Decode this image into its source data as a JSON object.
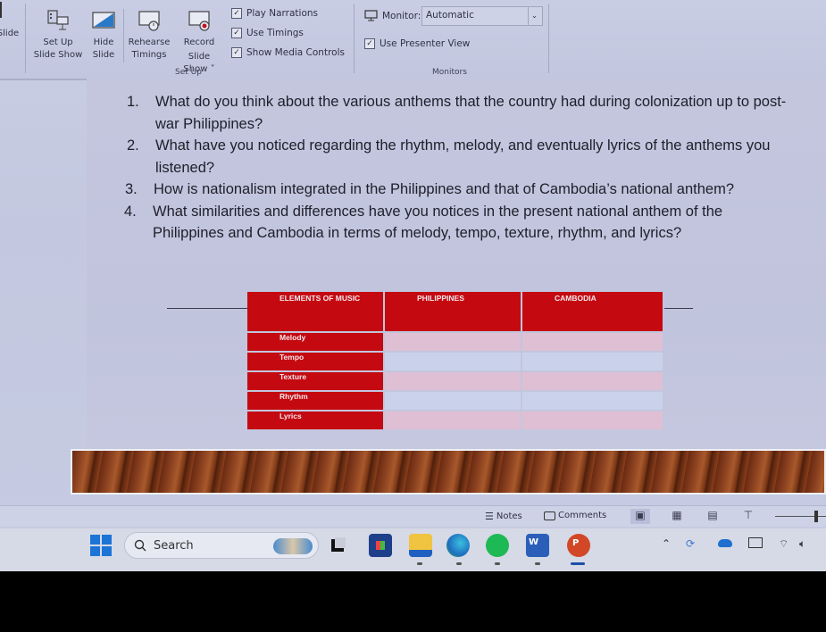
{
  "ribbon": {
    "partial_left_label": "Slide",
    "buttons": {
      "setup_slideshow": "Set Up\nSlide Show",
      "setup_line1": "Set Up",
      "setup_line2": "Slide Show",
      "hide_line1": "Hide",
      "hide_line2": "Slide",
      "rehearse_line1": "Rehearse",
      "rehearse_line2": "Timings",
      "record_line1": "Record Slide",
      "record_line2": "Show ˅"
    },
    "checkboxes": [
      {
        "label": "Play Narrations",
        "checked": true
      },
      {
        "label": "Use Timings",
        "checked": true
      },
      {
        "label": "Show Media Controls",
        "checked": true
      }
    ],
    "setup_group_label": "Set Up",
    "monitor_label": "Monitor:",
    "monitor_value": "Automatic",
    "presenter_view": {
      "label": "Use Presenter View",
      "checked": true
    },
    "monitors_group_label": "Monitors",
    "check_glyph": "✓"
  },
  "slide": {
    "questions": [
      {
        "num": "1.",
        "text": "What do you think about the various anthems that the country had during colonization up to post-war Philippines?"
      },
      {
        "num": "2.",
        "text": "What have you noticed regarding the rhythm, melody, and eventually lyrics of the anthems you listened?"
      },
      {
        "num": "3.",
        "text": "How is nationalism integrated in the Philippines and that of Cambodia’s national anthem?"
      },
      {
        "num": "4.",
        "text": "What similarities and differences have you notices in the present national anthem of the Philippines and Cambodia in terms of melody, tempo, texture, rhythm, and lyrics?"
      }
    ],
    "table": {
      "headers": [
        "ELEMENTS OF MUSIC",
        "PHILIPPINES",
        "CAMBODIA"
      ],
      "rows": [
        {
          "label": "Melody",
          "philippines": "",
          "cambodia": ""
        },
        {
          "label": "Tempo",
          "philippines": "",
          "cambodia": ""
        },
        {
          "label": "Texture",
          "philippines": "",
          "cambodia": ""
        },
        {
          "label": "Rhythm",
          "philippines": "",
          "cambodia": ""
        },
        {
          "label": "Lyrics",
          "philippines": "",
          "cambodia": ""
        }
      ],
      "colors": {
        "header": "#c40a10",
        "row_pink": "#dfbfd3",
        "row_blue": "#c9d2ea"
      }
    }
  },
  "statusbar": {
    "notes_label": "Notes",
    "comments_label": "Comments",
    "views": [
      "normal-view",
      "slide-sorter",
      "reading-view",
      "slide-show"
    ]
  },
  "taskbar": {
    "search_placeholder": "Search",
    "apps": [
      "task-view",
      "microsoft-store",
      "file-explorer",
      "edge",
      "spotify",
      "word",
      "powerpoint"
    ],
    "tray": [
      "chevron-up",
      "sync",
      "onedrive",
      "cast",
      "wifi",
      "volume"
    ]
  }
}
